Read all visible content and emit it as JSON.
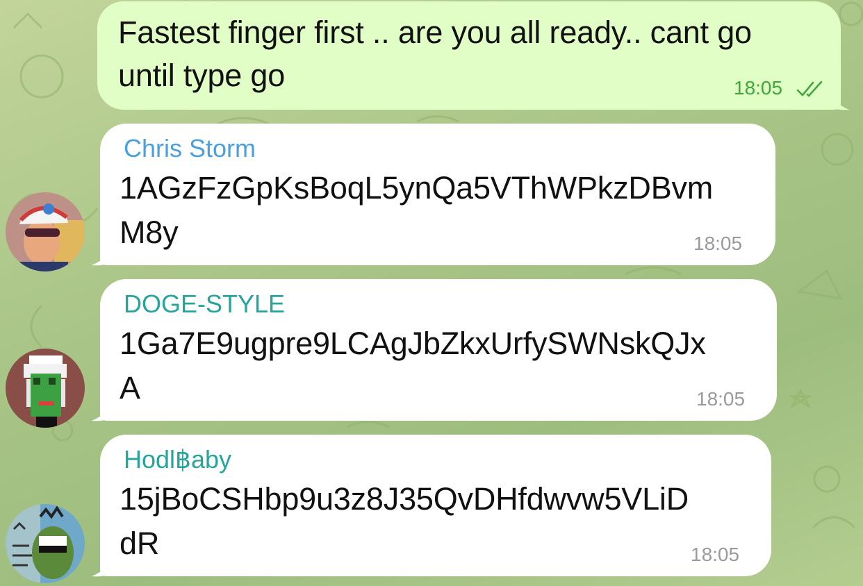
{
  "messages": [
    {
      "direction": "outgoing",
      "text_line1": "Fastest finger first .. are you all ready.. cant go",
      "text_line2": "until type go",
      "time": "18:05",
      "status_icon": "double-check-icon"
    },
    {
      "direction": "incoming",
      "sender": "Chris Storm",
      "sender_color": "#4a9fdf",
      "text_line1": "1AGzFzGpKsBoqL5ynQa5VThWPkzDBvm",
      "text_line2": "M8y",
      "time": "18:05",
      "avatar_icon": "user-avatar-photo"
    },
    {
      "direction": "incoming",
      "sender": "DOGE-STYLE",
      "sender_color": "#27a59a",
      "text_line1": "1Ga7E9ugpre9LCAgJbZkxUrfySWNskQJx",
      "text_line2": "A",
      "time": "18:05",
      "avatar_icon": "pixel-art-avatar"
    },
    {
      "direction": "incoming",
      "sender": "Hodl฿aby",
      "sender_color": "#27a59a",
      "text_line1": "15jBoCSHbp9u3z8J35QvDHfdwvw5VLiD",
      "text_line2": "dR",
      "time": "18:05",
      "avatar_icon": "pepe-art-avatar"
    }
  ],
  "colors": {
    "outgoing_bubble": "#e1fec6",
    "incoming_bubble": "#ffffff",
    "outgoing_time": "#3ea83a",
    "incoming_time": "#9a9a9a"
  }
}
